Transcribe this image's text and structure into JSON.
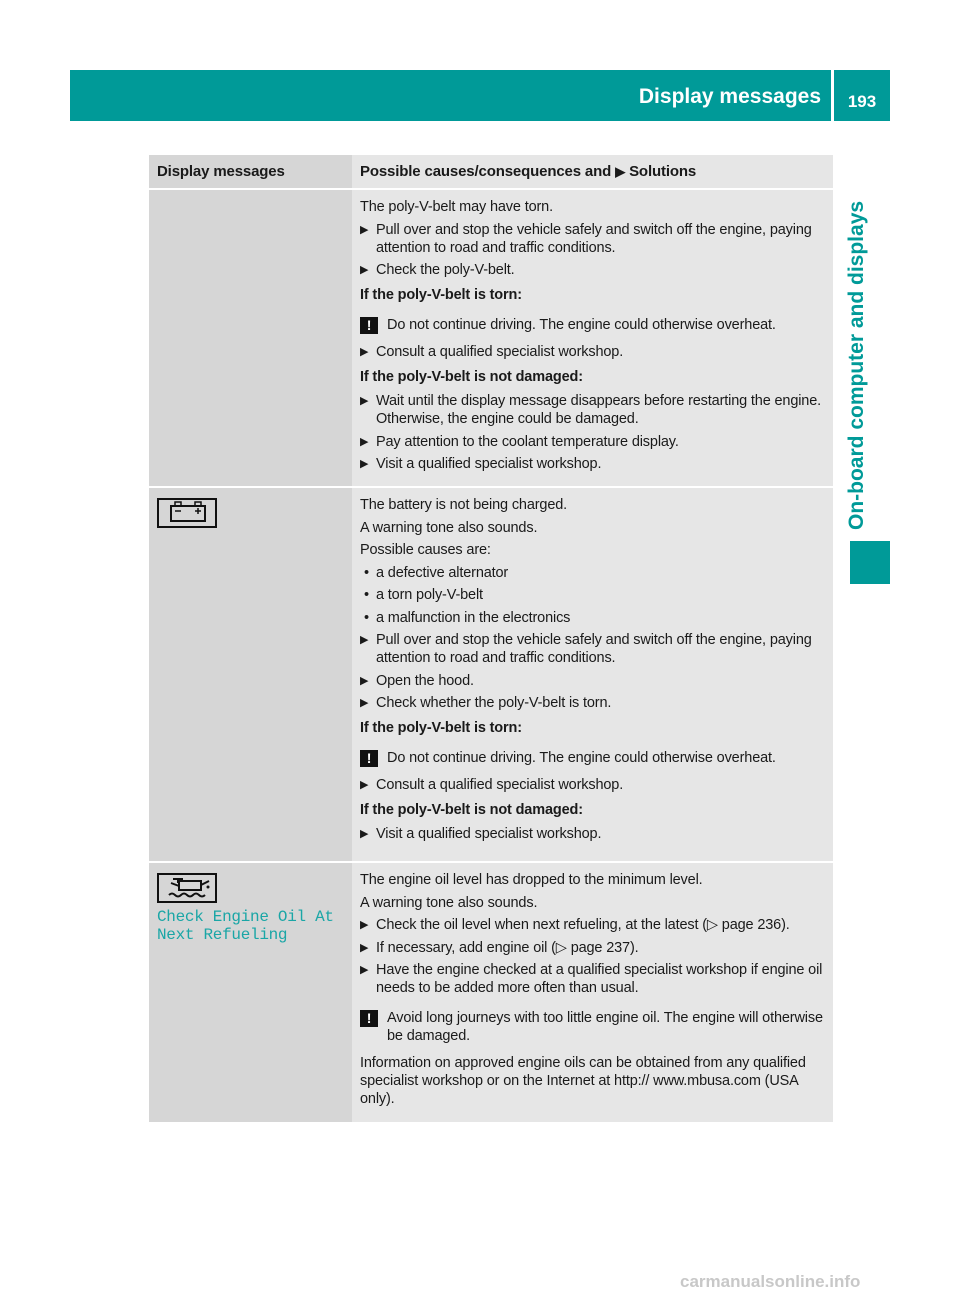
{
  "header": {
    "title": "Display messages",
    "page_number": "193"
  },
  "side_tab": "On-board computer and displays",
  "table": {
    "col1": "Display messages",
    "col2_prefix": "Possible causes/consequences and",
    "col2_suffix": "Solutions",
    "rows": [
      {
        "icon": "",
        "items": [
          "The poly-V-belt may have torn.",
          "Pull over and stop the vehicle safely and switch off the engine, paying attention to road and traffic conditions.",
          "Check the poly-V-belt.",
          "If the poly-V-belt is torn:",
          "Do not continue driving. The engine could otherwise overheat.",
          "Consult a qualified specialist workshop.",
          "If the poly-V-belt is not damaged:",
          "Wait until the display message disappears before restarting the engine. Otherwise, the engine could be damaged.",
          "Pay attention to the coolant temperature display.",
          "Visit a qualified specialist workshop."
        ]
      },
      {
        "icon": "battery-icon",
        "items": [
          "The battery is not being charged.",
          "A warning tone also sounds.",
          "Possible causes are:",
          "a defective alternator",
          "a torn poly-V-belt",
          "a malfunction in the electronics",
          "Pull over and stop the vehicle safely and switch off the engine, paying attention to road and traffic conditions.",
          "Open the hood.",
          "Check whether the poly-V-belt is torn.",
          "If the poly-V-belt is torn:",
          "Do not continue driving. The engine could otherwise overheat.",
          "Consult a qualified specialist workshop.",
          "If the poly-V-belt is not damaged:",
          "Visit a qualified specialist workshop."
        ]
      },
      {
        "icon": "oil-can-icon",
        "message_line1": "Check Engine Oil At",
        "message_line2": "Next Refueling",
        "items": [
          "The engine oil level has dropped to the minimum level.",
          "A warning tone also sounds.",
          "Check the oil level when next refueling, at the latest (▷ page 236).",
          "If necessary, add engine oil (▷ page 237).",
          "Have the engine checked at a qualified specialist workshop if engine oil needs to be added more often than usual.",
          "Avoid long journeys with too little engine oil. The engine will otherwise be damaged.",
          "Information on approved engine oils can be obtained from any qualified specialist workshop or on the Internet at http:// www.mbusa.com (USA only)."
        ]
      }
    ]
  },
  "colors": {
    "accent": "#009a98",
    "left_cell": "#d6d6d6",
    "right_cell": "#e6e6e6",
    "display_text": "#1aa6a6"
  },
  "watermark": "carmanualsonline.info"
}
